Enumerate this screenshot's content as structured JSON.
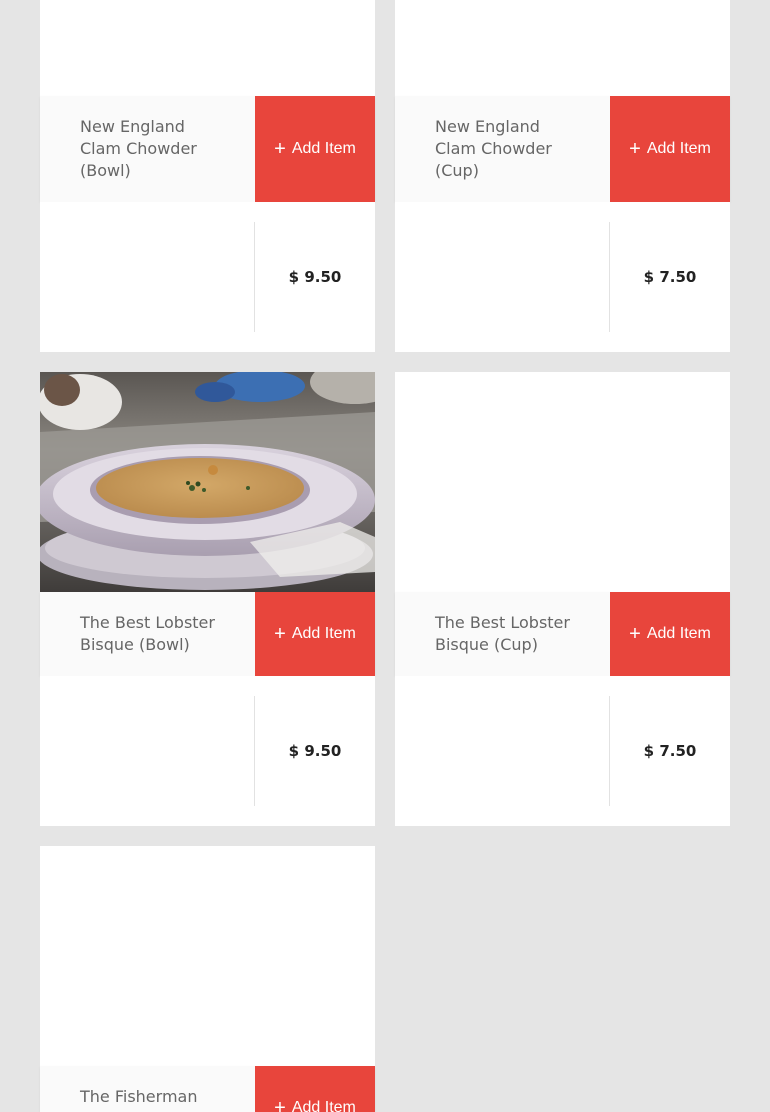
{
  "colors": {
    "page_bg": "#e5e5e5",
    "card_bg": "#ffffff",
    "accent": "#e8453c",
    "title_text": "#666666",
    "price_text": "#222222"
  },
  "menu": {
    "items": [
      {
        "name": "New England Clam Chowder (Bowl)",
        "add_label": "Add Item",
        "add_icon": "plus-icon",
        "price": "$ 9.50"
      },
      {
        "name": "New England Clam Chowder (Cup)",
        "add_label": "Add Item",
        "add_icon": "plus-icon",
        "price": "$ 7.50"
      },
      {
        "name": "The Best Lobster Bisque (Bowl)",
        "add_label": "Add Item",
        "add_icon": "plus-icon",
        "price": "$ 9.50",
        "photo": "lobster-bisque-bowl-photo"
      },
      {
        "name": "The Best Lobster Bisque (Cup)",
        "add_label": "Add Item",
        "add_icon": "plus-icon",
        "price": "$ 7.50"
      },
      {
        "name": "The Fisherman",
        "add_label": "Add Item",
        "add_icon": "plus-icon"
      }
    ]
  }
}
